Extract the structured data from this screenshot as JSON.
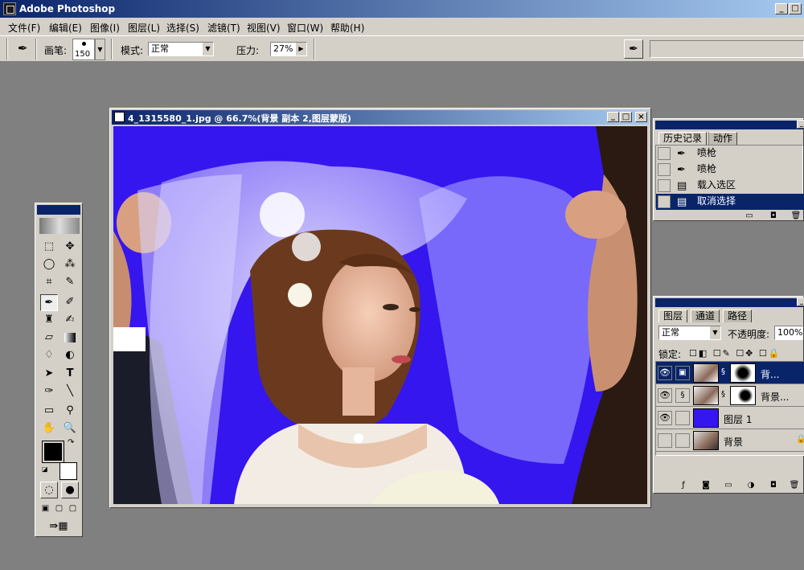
{
  "app": {
    "title": "Adobe Photoshop",
    "min": "_",
    "max": "□",
    "close": "×"
  },
  "menu": [
    "文件(F)",
    "编辑(E)",
    "图像(I)",
    "图层(L)",
    "选择(S)",
    "滤镜(T)",
    "视图(V)",
    "窗口(W)",
    "帮助(H)"
  ],
  "options": {
    "brush_label": "画笔:",
    "brush_size": "150",
    "mode_label": "模式:",
    "mode_value": "正常",
    "pressure_label": "压力:",
    "pressure_value": "27%"
  },
  "document": {
    "title": "4_1315580_1.jpg @ 66.7%(背景 副本 2,图层蒙版)",
    "canvas_color": "#3516ee"
  },
  "history": {
    "tabs": [
      "历史记录",
      "动作"
    ],
    "items": [
      {
        "label": "喷枪",
        "icon": "airbrush-icon"
      },
      {
        "label": "喷枪",
        "icon": "airbrush-icon"
      },
      {
        "label": "载入选区",
        "icon": "document-icon"
      },
      {
        "label": "取消选择",
        "icon": "document-icon",
        "selected": true
      }
    ]
  },
  "layers": {
    "tabs": [
      "图层",
      "通道",
      "路径"
    ],
    "blend_mode": "正常",
    "opacity_label": "不透明度:",
    "opacity_value": "100%",
    "lock_label": "锁定:",
    "items": [
      {
        "name": "背...",
        "selected": true
      },
      {
        "name": "背景..."
      },
      {
        "name": "图层 1"
      },
      {
        "name": "背景"
      }
    ]
  },
  "colors": {
    "foreground": "#000000",
    "background": "#ffffff",
    "accent": "#0a246a"
  }
}
